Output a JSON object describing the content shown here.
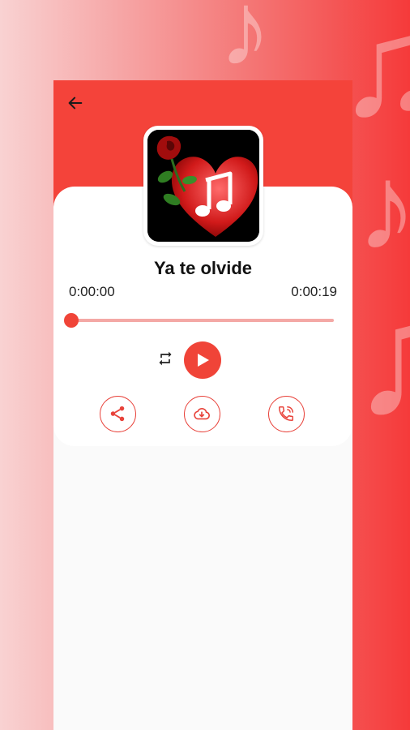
{
  "background": {
    "note_glyph": "♫",
    "note_glyph_single": "♪"
  },
  "player": {
    "song_title": "Ya te olvide",
    "time_current": "0:00:00",
    "time_total": "0:00:19",
    "progress": 0.0
  },
  "icons": {
    "back": "arrow-left-icon",
    "repeat": "repeat-icon",
    "play": "play-icon",
    "share": "share-icon",
    "download": "cloud-download-icon",
    "ringtone": "phone-ring-icon"
  },
  "colors": {
    "accent": "#f04438",
    "header": "#f4433a",
    "track": "#f4a8a5"
  }
}
